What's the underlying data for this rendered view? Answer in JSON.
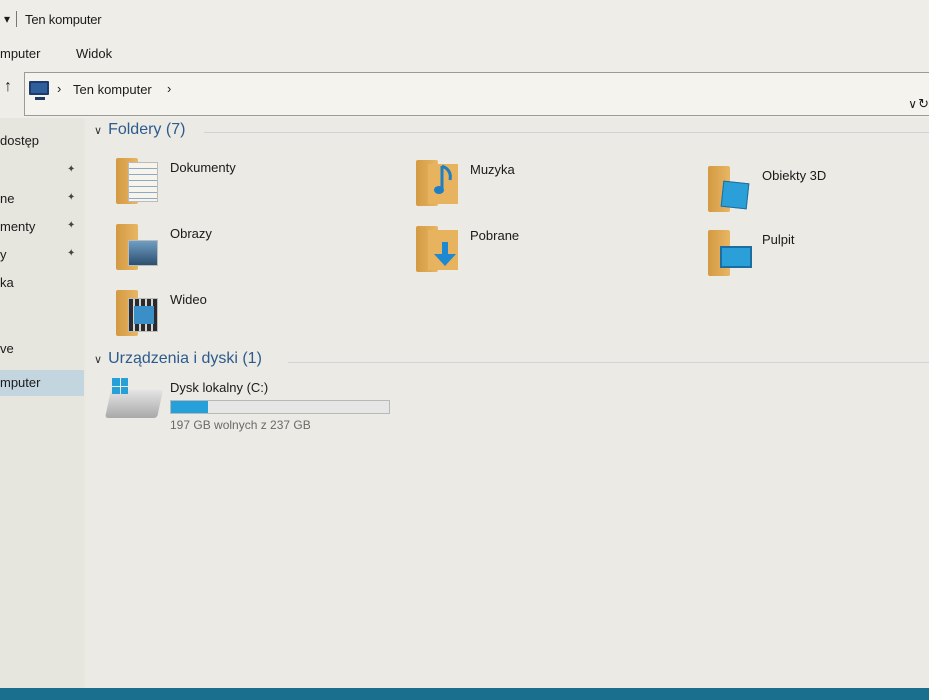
{
  "window": {
    "title": "Ten komputer",
    "quick_access_glyph": "▾"
  },
  "ribbon": {
    "tabs": [
      "mputer",
      "Widok"
    ]
  },
  "address": {
    "crumb": "Ten komputer",
    "separator": "›",
    "up_glyph": "↑",
    "dropdown_glyph": "∨",
    "refresh_glyph": "↻"
  },
  "sidebar": {
    "items": [
      {
        "label": "dostęp",
        "pinned": false,
        "selected": false
      },
      {
        "label": "",
        "pinned": true,
        "selected": false
      },
      {
        "label": "ne",
        "pinned": true,
        "selected": false
      },
      {
        "label": "menty",
        "pinned": true,
        "selected": false
      },
      {
        "label": "y",
        "pinned": true,
        "selected": false
      },
      {
        "label": "ka",
        "pinned": false,
        "selected": false
      },
      {
        "label": "",
        "pinned": false,
        "selected": false
      },
      {
        "label": "ve",
        "pinned": false,
        "selected": false
      },
      {
        "label": "mputer",
        "pinned": false,
        "selected": true
      }
    ],
    "pin_glyph": "📌"
  },
  "main": {
    "folders_group": {
      "title": "Foldery (7)"
    },
    "folders": [
      {
        "name": "Dokumenty",
        "icon": "documents-folder-icon"
      },
      {
        "name": "Muzyka",
        "icon": "music-folder-icon"
      },
      {
        "name": "Obiekty 3D",
        "icon": "3d-objects-folder-icon"
      },
      {
        "name": "Obrazy",
        "icon": "pictures-folder-icon"
      },
      {
        "name": "Pobrane",
        "icon": "downloads-folder-icon"
      },
      {
        "name": "Pulpit",
        "icon": "desktop-folder-icon"
      },
      {
        "name": "Wideo",
        "icon": "videos-folder-icon"
      }
    ],
    "devices_group": {
      "title": "Urządzenia i dyski (1)"
    },
    "drive": {
      "name": "Dysk lokalny (C:)",
      "free_text": "197 GB wolnych z 237 GB",
      "used_fraction": 0.17
    }
  },
  "colors": {
    "accent": "#26a0da",
    "group_title": "#2d5b8e",
    "folder": "#e2ad5a"
  }
}
